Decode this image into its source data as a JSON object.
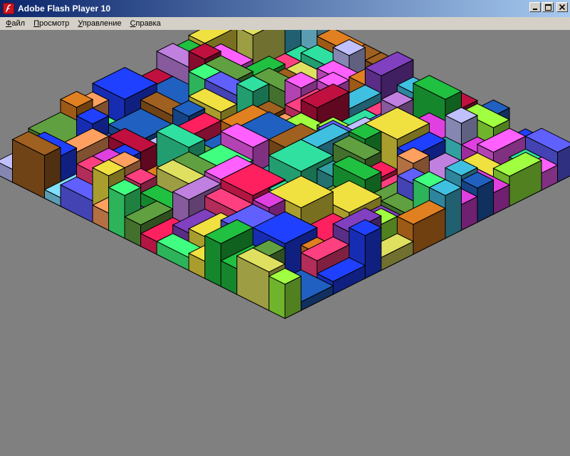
{
  "window": {
    "title": "Adobe Flash Player 10",
    "icon": "flash-player-icon",
    "controls": [
      "minimize-icon",
      "maximize-icon",
      "close-icon"
    ]
  },
  "menubar": {
    "items": [
      {
        "accel": "Ф",
        "rest": "айл"
      },
      {
        "accel": "П",
        "rest": "росмотр"
      },
      {
        "accel": "У",
        "rest": "правление"
      },
      {
        "accel": "С",
        "rest": "правка"
      }
    ]
  },
  "stage": {
    "floor_color": "#808080",
    "outline_color": "#000000"
  }
}
